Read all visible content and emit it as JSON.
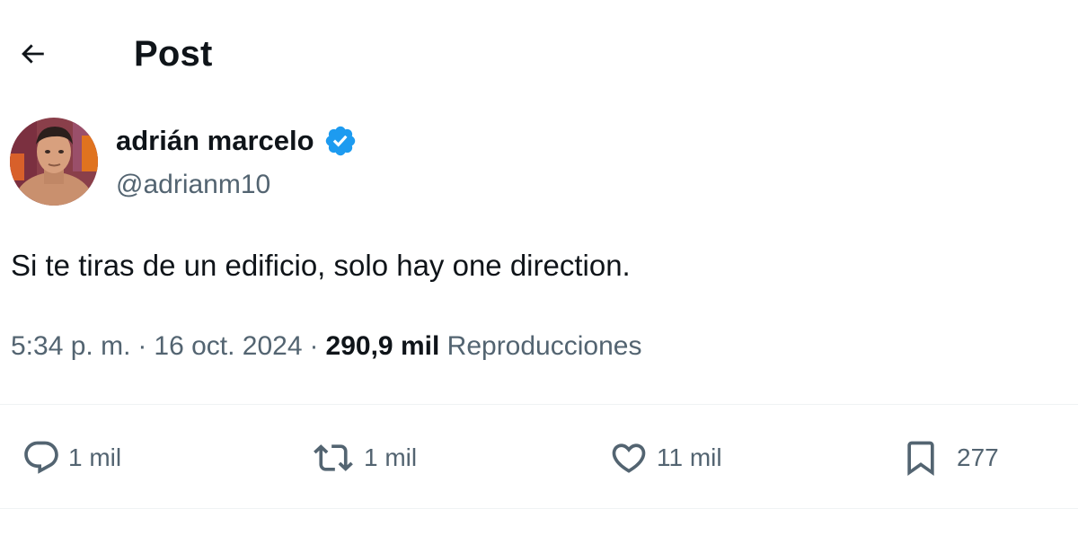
{
  "header": {
    "title": "Post"
  },
  "author": {
    "display_name": "adrián marcelo",
    "handle": "@adrianm10",
    "verified": true
  },
  "post": {
    "text": "Si te tiras de un edificio, solo hay one direction.",
    "time": "5:34 p. m.",
    "separator": "·",
    "date": "16 oct. 2024",
    "views_count": "290,9 mil",
    "views_label": "Reproducciones"
  },
  "actions": {
    "reply_count": "1 mil",
    "retweet_count": "1 mil",
    "like_count": "11 mil",
    "bookmark_count": "277"
  },
  "colors": {
    "text_primary": "#0f1419",
    "text_secondary": "#536471",
    "verified_blue": "#1d9bf0",
    "divider": "#eff3f4"
  },
  "icons": {
    "back": "arrow-left-icon",
    "verified": "verified-badge-icon",
    "reply": "speech-bubble-icon",
    "retweet": "retweet-arrows-icon",
    "like": "heart-icon",
    "bookmark": "bookmark-icon"
  }
}
